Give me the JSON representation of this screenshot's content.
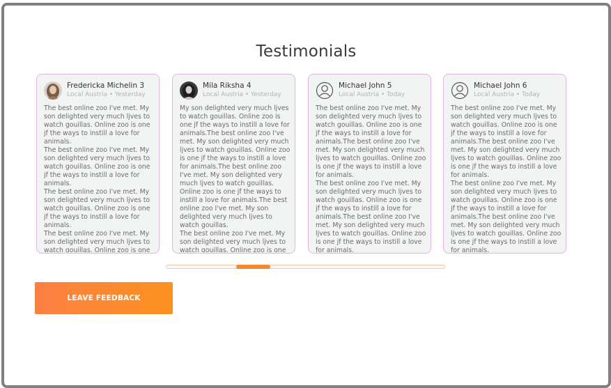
{
  "section": {
    "title": "Testimonials"
  },
  "testimonials": [
    {
      "name": "Fredericka Michelin 3",
      "meta": "Local Austria • Yesterday",
      "avatar": "woman-photo-avatar",
      "text": "The best online zoo I've met. My son delighted very much ljves to watch gouillas. Online zoo is one jf the ways to instill a love for animals.\nThe best online zoo I've met. My son delighted very much ljves to watch gouillas. Online zoo is one jf the ways to instill a love for animals.\nThe best online zoo I've met. My son delighted very much ljves to watch gouillas. Online zoo is one jf the ways to instill a love for animals.\nThe best online zoo I've met. My son delighted very much ljves to watch gouillas. Online zoo is one jf the ways to instill a love for animals.The best online zoo I've met. My son delighted very much ljves to watch gouillas. Online zoo is one jf the ways to instill a love for animals."
    },
    {
      "name": "Mila Riksha 4",
      "meta": "Local Austria • Yesterday",
      "avatar": "woman-photo-avatar",
      "text": "My son delighted very much ljves to watch gouillas. Online zoo is one jf the ways to instill a love for animals.The best online zoo I've met. My son delighted very much ljves to watch gouillas. Online zoo is one jf the ways to instill a love for animals.The best online zoo I've met. My son delighted very much ljves to watch gouillas. Online zoo is one jf the ways to instill a love for animals.The best online zoo I've met. My son delighted very much ljves to watch gouillas.\nThe best online zoo I've met. My son delighted very much ljves to watch gouillas. Online zoo is one jf the ways to instill a love for animals.The best online zoo I've met."
    },
    {
      "name": "Michael John 5",
      "meta": "Local Austria • Today",
      "avatar": "user-outline-icon",
      "text": "The best online zoo I've met. My son delighted very much ljves to watch gouillas. Online zoo is one jf the ways to instill a love for animals.The best online zoo I've met. My son delighted very much ljves to watch gouillas. Online zoo is one jf the ways to instill a love for animals.\nThe best online zoo I've met. My son delighted very much ljves to watch gouillas. Online zoo is one jf the ways to instill a love for animals.The best online zoo I've met. My son delighted very much ljves to watch gouillas. Online zoo is one jf the ways to instill a love for animals."
    },
    {
      "name": "Michael John 6",
      "meta": "Local Austria • Today",
      "avatar": "user-outline-icon",
      "text": "The best online zoo I've met. My son delighted very much ljves to watch gouillas. Online zoo is one jf the ways to instill a love for animals.The best online zoo I've met. My son delighted very much ljves to watch gouillas. Online zoo is one jf the ways to instill a love for animals.\nThe best online zoo I've met. My son delighted very much ljves to watch gouillas. Online zoo is one jf the ways to instill a love for animals.The best online zoo I've met. My son delighted very much ljves to watch gouillas. Online zoo is one jf the ways to instill a love for animals."
    }
  ],
  "carousel": {
    "position": 0.25
  },
  "feedback_button": {
    "label": "LEAVE FEEDBACK"
  },
  "colors": {
    "accent": "#fd8a2e",
    "card_border": "#e1b3e6",
    "card_bg": "#f2f3f3"
  }
}
